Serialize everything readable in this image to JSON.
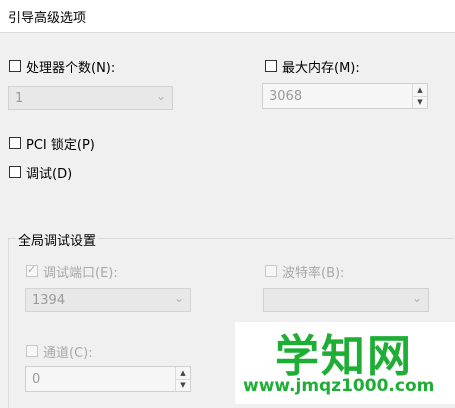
{
  "window": {
    "title": "引导高级选项"
  },
  "processors": {
    "label": "处理器个数(N):",
    "value": "1",
    "checked": false
  },
  "max_memory": {
    "label": "最大内存(M):",
    "value": "3068",
    "checked": false
  },
  "pci_lock": {
    "label": "PCI 锁定(P)",
    "checked": false
  },
  "debug": {
    "label": "调试(D)",
    "checked": false
  },
  "global_debug": {
    "title": "全局调试设置",
    "debug_port": {
      "label": "调试端口(E):",
      "value": "1394",
      "checked": true
    },
    "baud_rate": {
      "label": "波特率(B):",
      "value": ""
    },
    "channel": {
      "label": "通道(C):",
      "value": "0"
    }
  },
  "watermark": {
    "text": "学知网",
    "url": "www.jmqz1000.com"
  },
  "icons": {
    "dropdown": "chevron-down-icon",
    "spin_up": "spin-up-icon",
    "spin_down": "spin-down-icon"
  },
  "colors": {
    "watermark_green": "#1fae35",
    "background": "#f0f0f0"
  }
}
